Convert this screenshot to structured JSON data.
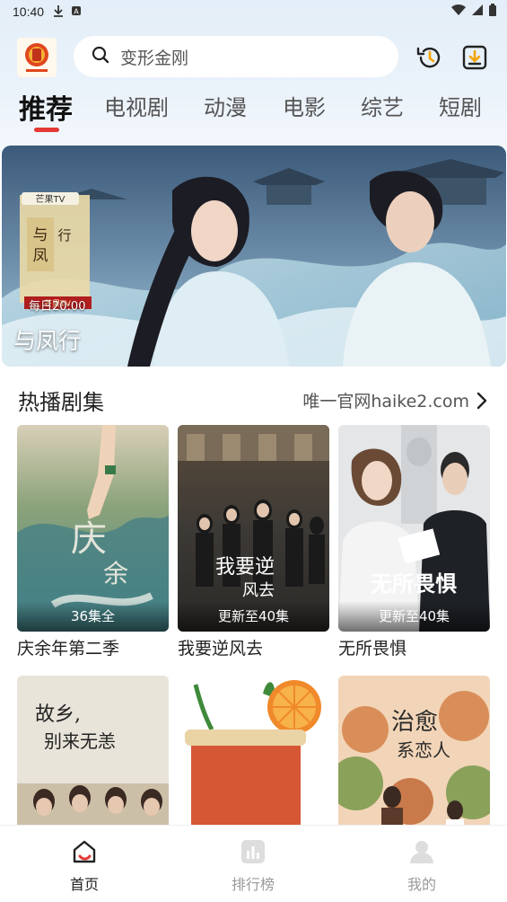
{
  "status": {
    "time": "10:40"
  },
  "search": {
    "placeholder": "变形金刚"
  },
  "tabs": [
    {
      "label": "推荐",
      "active": true
    },
    {
      "label": "电视剧"
    },
    {
      "label": "动漫"
    },
    {
      "label": "电影"
    },
    {
      "label": "综艺"
    },
    {
      "label": "短剧"
    }
  ],
  "banner": {
    "title": "与凤行",
    "poster_title": "与凤行",
    "badge": "每日20:00",
    "brand": "芒果TV"
  },
  "hot_section": {
    "title": "热播剧集",
    "more": "唯一官网haike2.com"
  },
  "cards": [
    {
      "name": "庆余年第二季",
      "episodes": "36集全",
      "poster_text": "庆余年"
    },
    {
      "name": "我要逆风去",
      "episodes": "更新至40集",
      "poster_text": "我要逆风去"
    },
    {
      "name": "无所畏惧",
      "episodes": "更新至40集",
      "poster_text": "无所畏惧"
    }
  ],
  "cards_row2": [
    {
      "poster_text": "故乡，别来无恙"
    },
    {
      "poster_text": ""
    },
    {
      "poster_text": "治愈系恋人"
    }
  ],
  "bottom_nav": [
    {
      "label": "首页",
      "active": true
    },
    {
      "label": "排行榜"
    },
    {
      "label": "我的"
    }
  ],
  "colors": {
    "accent": "#e53935",
    "tab_indicator": "#e53935"
  }
}
